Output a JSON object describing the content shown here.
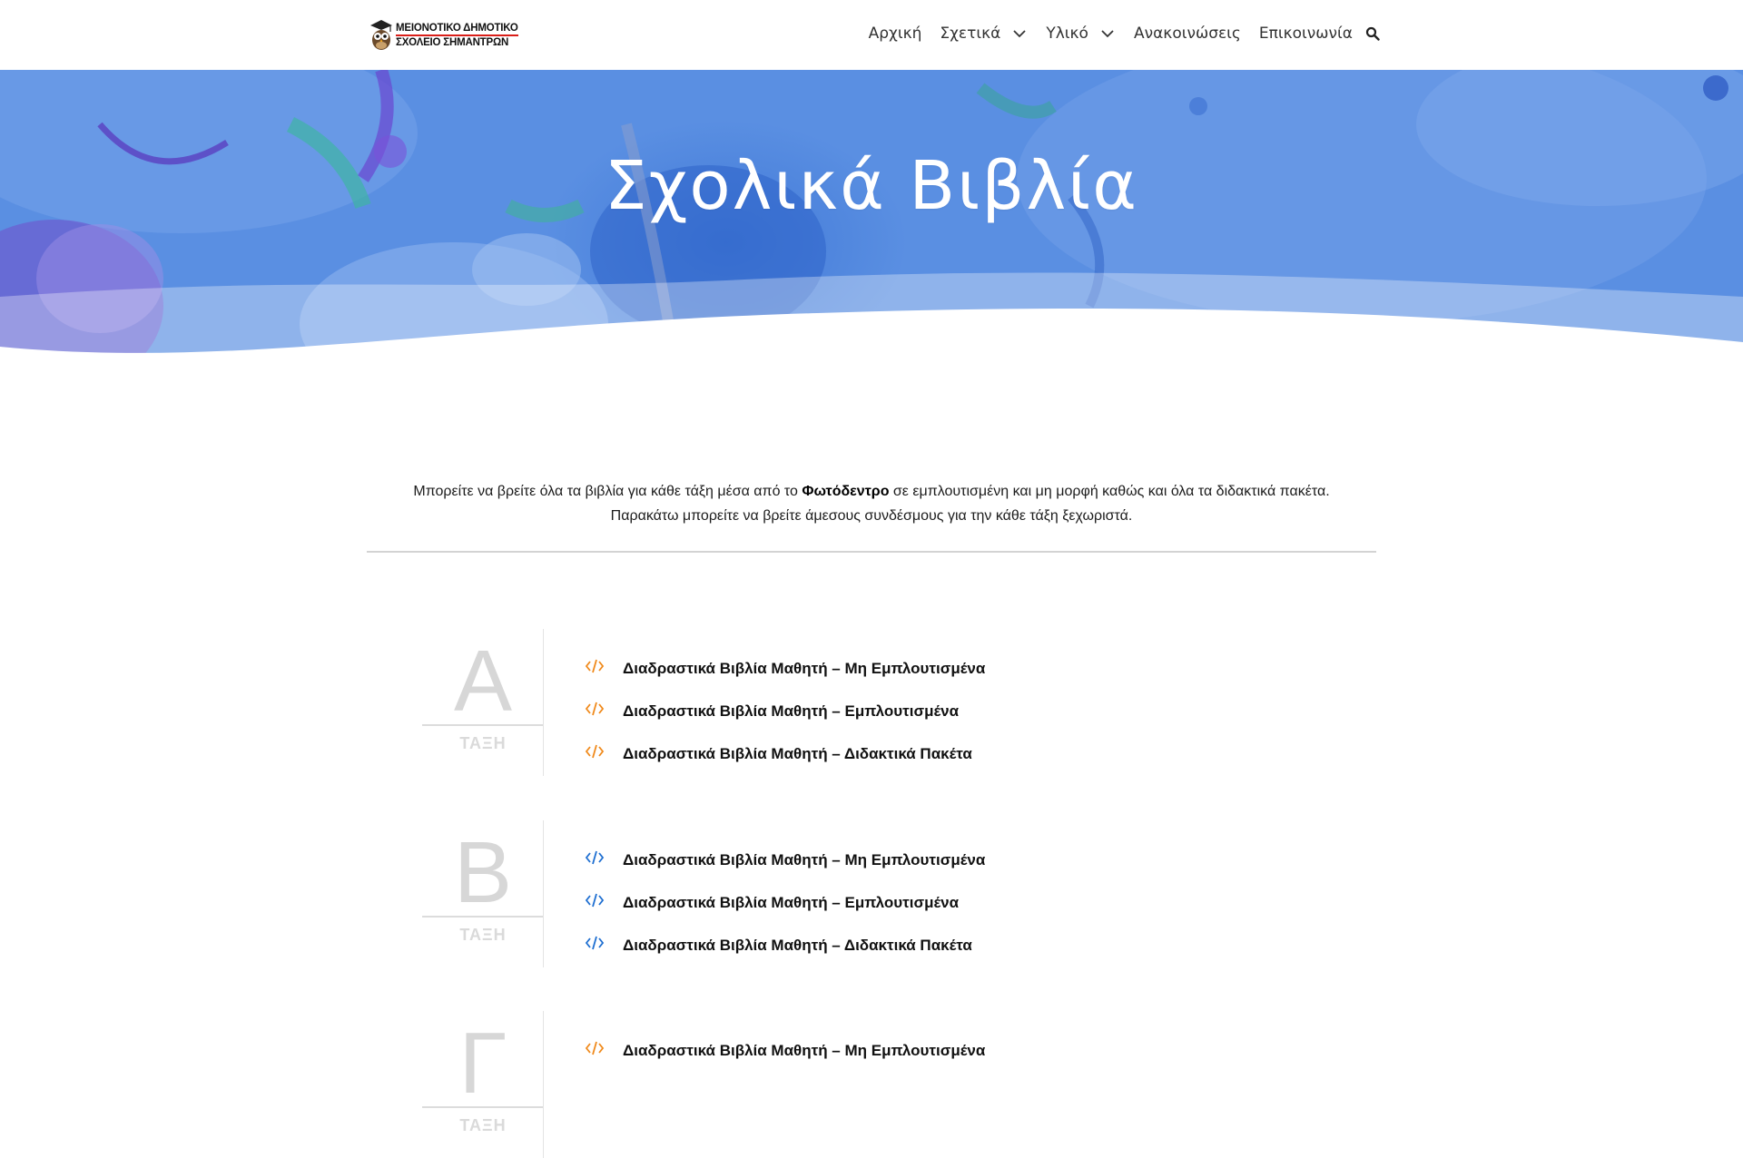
{
  "header": {
    "logo": {
      "line1": "ΜΕΙΟΝΟΤΙΚΟ ΔΗΜΟΤΙΚΟ",
      "line2": "ΣΧΟΛΕΙΟ ΣΗΜΑΝΤΡΩΝ"
    },
    "nav": [
      {
        "label": "Αρχική",
        "has_dropdown": false
      },
      {
        "label": "Σχετικά",
        "has_dropdown": true
      },
      {
        "label": "Υλικό",
        "has_dropdown": true
      },
      {
        "label": "Ανακοινώσεις",
        "has_dropdown": false
      },
      {
        "label": "Επικοινωνία",
        "has_dropdown": false
      }
    ],
    "search_icon": "search-icon"
  },
  "hero": {
    "title": "Σχολικά Βιβλία"
  },
  "intro": {
    "line1_before": "Μπορείτε να βρείτε όλα τα βιβλία για κάθε τάξη μέσα από το ",
    "line1_bold": "Φωτόδεντρο",
    "line1_after": " σε εμπλουτισμένη και μη μορφή καθώς και όλα τα διδακτικά πακέτα.",
    "line2": "Παρακάτω μπορείτε να βρείτε άμεσους συνδέσμους για την κάθε τάξη ξεχωριστά."
  },
  "grades": [
    {
      "letter": "Α",
      "caption": "ΤΑΞΗ",
      "icon_color": "#f08a1c",
      "links": [
        "Διαδραστικά Βιβλία Μαθητή – Μη Εμπλουτισμένα",
        "Διαδραστικά Βιβλία Μαθητή – Εμπλουτισμένα",
        "Διαδραστικά Βιβλία Μαθητή – Διδακτικά Πακέτα"
      ]
    },
    {
      "letter": "Β",
      "caption": "ΤΑΞΗ",
      "icon_color": "#1f6fd1",
      "links": [
        "Διαδραστικά Βιβλία Μαθητή – Μη Εμπλουτισμένα",
        "Διαδραστικά Βιβλία Μαθητή – Εμπλουτισμένα",
        "Διαδραστικά Βιβλία Μαθητή – Διδακτικά Πακέτα"
      ]
    },
    {
      "letter": "Γ",
      "caption": "ΤΑΞΗ",
      "icon_color": "#f08a1c",
      "links": [
        "Διαδραστικά Βιβλία Μαθητή – Μη Εμπλουτισμένα"
      ]
    }
  ],
  "colors": {
    "hero_blue": "#4f86dd",
    "accent_orange": "#f08a1c",
    "accent_blue": "#1f6fd1",
    "grade_gray": "#d7d7d7"
  }
}
